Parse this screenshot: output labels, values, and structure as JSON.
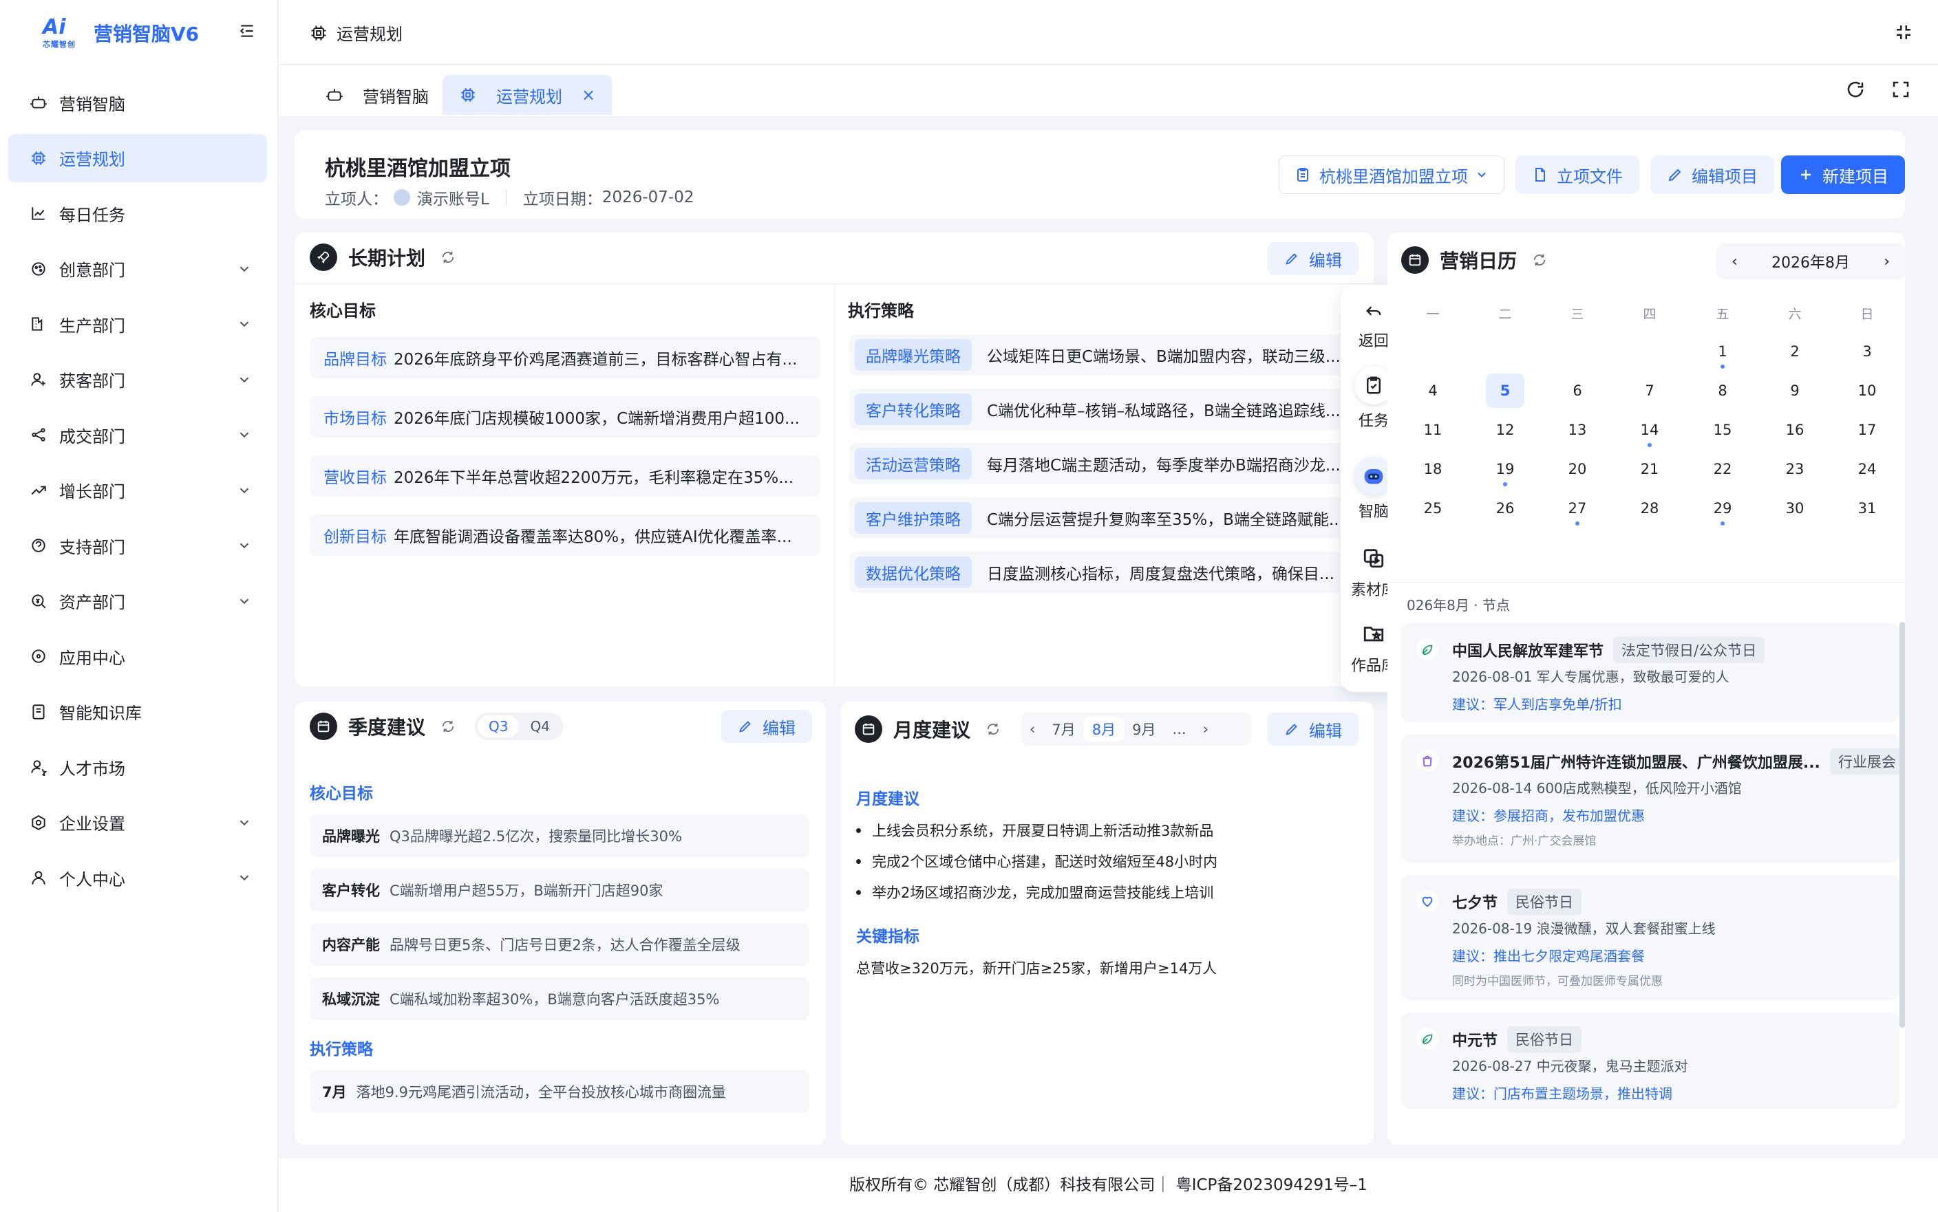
{
  "app": {
    "brand_name": "营销智脑V6",
    "logo_text": "Ai",
    "logo_sub": "芯耀智创"
  },
  "sidebar": {
    "items": [
      {
        "label": "营销智脑",
        "icon": "robot-icon",
        "has_children": false,
        "active": false
      },
      {
        "label": "运营规划",
        "icon": "chip-icon",
        "has_children": false,
        "active": true
      },
      {
        "label": "每日任务",
        "icon": "chart-line-icon",
        "has_children": false,
        "active": false
      },
      {
        "label": "创意部门",
        "icon": "palette-icon",
        "has_children": true,
        "active": false
      },
      {
        "label": "生产部门",
        "icon": "factory-icon",
        "has_children": true,
        "active": false
      },
      {
        "label": "获客部门",
        "icon": "user-plus-icon",
        "has_children": true,
        "active": false
      },
      {
        "label": "成交部门",
        "icon": "share-icon",
        "has_children": true,
        "active": false
      },
      {
        "label": "增长部门",
        "icon": "trend-up-icon",
        "has_children": true,
        "active": false
      },
      {
        "label": "支持部门",
        "icon": "support-icon",
        "has_children": true,
        "active": false
      },
      {
        "label": "资产部门",
        "icon": "search-money-icon",
        "has_children": true,
        "active": false
      },
      {
        "label": "应用中心",
        "icon": "app-center-icon",
        "has_children": false,
        "active": false
      },
      {
        "label": "智能知识库",
        "icon": "book-icon",
        "has_children": false,
        "active": false
      },
      {
        "label": "人才市场",
        "icon": "talent-icon",
        "has_children": false,
        "active": false
      },
      {
        "label": "企业设置",
        "icon": "settings-icon",
        "has_children": true,
        "active": false
      },
      {
        "label": "个人中心",
        "icon": "user-icon",
        "has_children": true,
        "active": false
      }
    ]
  },
  "topbar": {
    "breadcrumb": "运营规划"
  },
  "tabs": [
    {
      "label": "营销智脑",
      "active": false
    },
    {
      "label": "运营规划",
      "active": true,
      "close": "×"
    }
  ],
  "project": {
    "title": "杭桃里酒馆加盟立项",
    "creator_label": "立项人：",
    "creator": "演示账号L",
    "date_label": "立项日期：",
    "date": "2026-07-02",
    "select_label": "杭桃里酒馆加盟立项",
    "file_btn": "立项文件",
    "edit_btn": "编辑项目",
    "new_btn": "新建项目"
  },
  "long_plan": {
    "title": "长期计划",
    "edit": "编辑",
    "goals_head": "核心目标",
    "goals": [
      {
        "k": "品牌目标",
        "v": "2026年底跻身平价鸡尾酒赛道前三，目标客群心智占有..."
      },
      {
        "k": "市场目标",
        "v": "2026年底门店规模破1000家，C端新增消费用户超100..."
      },
      {
        "k": "营收目标",
        "v": "2026年下半年总营收超2200万元，毛利率稳定在35%..."
      },
      {
        "k": "创新目标",
        "v": "年底智能调酒设备覆盖率达80%，供应链AI优化覆盖率..."
      }
    ],
    "strategy_head": "执行策略",
    "strategies": [
      {
        "k": "品牌曝光策略",
        "v": "公域矩阵日更C端场景、B端加盟内容，联动三级..."
      },
      {
        "k": "客户转化策略",
        "v": "C端优化种草–核销–私域路径，B端全链路追踪线..."
      },
      {
        "k": "活动运营策略",
        "v": "每月落地C端主题活动，每季度举办B端招商沙龙..."
      },
      {
        "k": "客户维护策略",
        "v": "C端分层运营提升复购率至35%，B端全链路赋能..."
      },
      {
        "k": "数据优化策略",
        "v": "日度监测核心指标，周度复盘迭代策略，确保目..."
      }
    ]
  },
  "quarter": {
    "title": "季度建议",
    "quarters": [
      "Q3",
      "Q4"
    ],
    "edit": "编辑",
    "goals_head": "核心目标",
    "goals": [
      {
        "k": "品牌曝光",
        "v": "Q3品牌曝光超2.5亿次，搜索量同比增长30%"
      },
      {
        "k": "客户转化",
        "v": "C端新增用户超55万，B端新开门店超90家"
      },
      {
        "k": "内容产能",
        "v": "品牌号日更5条、门店号日更2条，达人合作覆盖全层级"
      },
      {
        "k": "私域沉淀",
        "v": "C端私域加粉率超30%，B端意向客户活跃度超35%"
      }
    ],
    "strategy_head": "执行策略",
    "strategies": [
      {
        "k": "7月",
        "v": "落地9.9元鸡尾酒引流活动，全平台投放核心城市商圈流量"
      }
    ]
  },
  "month": {
    "title": "月度建议",
    "months": [
      "7月",
      "8月",
      "9月",
      "..."
    ],
    "edit": "编辑",
    "advice_head": "月度建议",
    "advice": [
      "上线会员积分系统，开展夏日特调上新活动推3款新品",
      "完成2个区域仓储中心搭建，配送时效缩短至48小时内",
      "举办2场区域招商沙龙，完成加盟商运营技能线上培训"
    ],
    "kpi_head": "关键指标",
    "kpi": "总营收≥320万元，新开门店≥25家，新增用户≥14万人"
  },
  "calendar": {
    "title": "营销日历",
    "month_label": "2026年8月",
    "weekdays": [
      "一",
      "二",
      "三",
      "四",
      "五",
      "六",
      "日"
    ],
    "today": 5,
    "first_weekday": 5,
    "days_in_month": 31,
    "dot_days": [
      1,
      14,
      19,
      27,
      29
    ],
    "node_label": "026年8月 · 节点",
    "events": [
      {
        "icon": "leaf-icon",
        "title": "中国人民解放军建军节",
        "tag": "法定节假日/公众节日",
        "desc": "2026-08-01 军人专属优惠，致敬最可爱的人",
        "suggest": "建议：军人到店享免单/折扣",
        "note": ""
      },
      {
        "icon": "bag-icon",
        "title": "2026第51届广州特许连锁加盟展、广州餐饮加盟展...",
        "tag": "行业展会",
        "desc": "2026-08-14 600店成熟模型，低风险开小酒馆",
        "suggest": "建议：参展招商，发布加盟优惠",
        "note": "举办地点：广州·广交会展馆"
      },
      {
        "icon": "heart-icon",
        "title": "七夕节",
        "tag": "民俗节日",
        "desc": "2026-08-19 浪漫微醺，双人套餐甜蜜上线",
        "suggest": "建议：推出七夕限定鸡尾酒套餐",
        "note": "同时为中国医师节，可叠加医师专属优惠"
      },
      {
        "icon": "leaf-icon",
        "title": "中元节",
        "tag": "民俗节日",
        "desc": "2026-08-27 中元夜聚，鬼马主题派对",
        "suggest": "建议：门店布置主题场景，推出特调",
        "note": ""
      }
    ]
  },
  "float_menu": {
    "items": [
      "返回",
      "任务",
      "智脑",
      "素材库",
      "作品库"
    ]
  },
  "footer": {
    "text": "版权所有©  芯耀智创（成都）科技有限公司｜ 粤ICP备2023094291号–1"
  }
}
